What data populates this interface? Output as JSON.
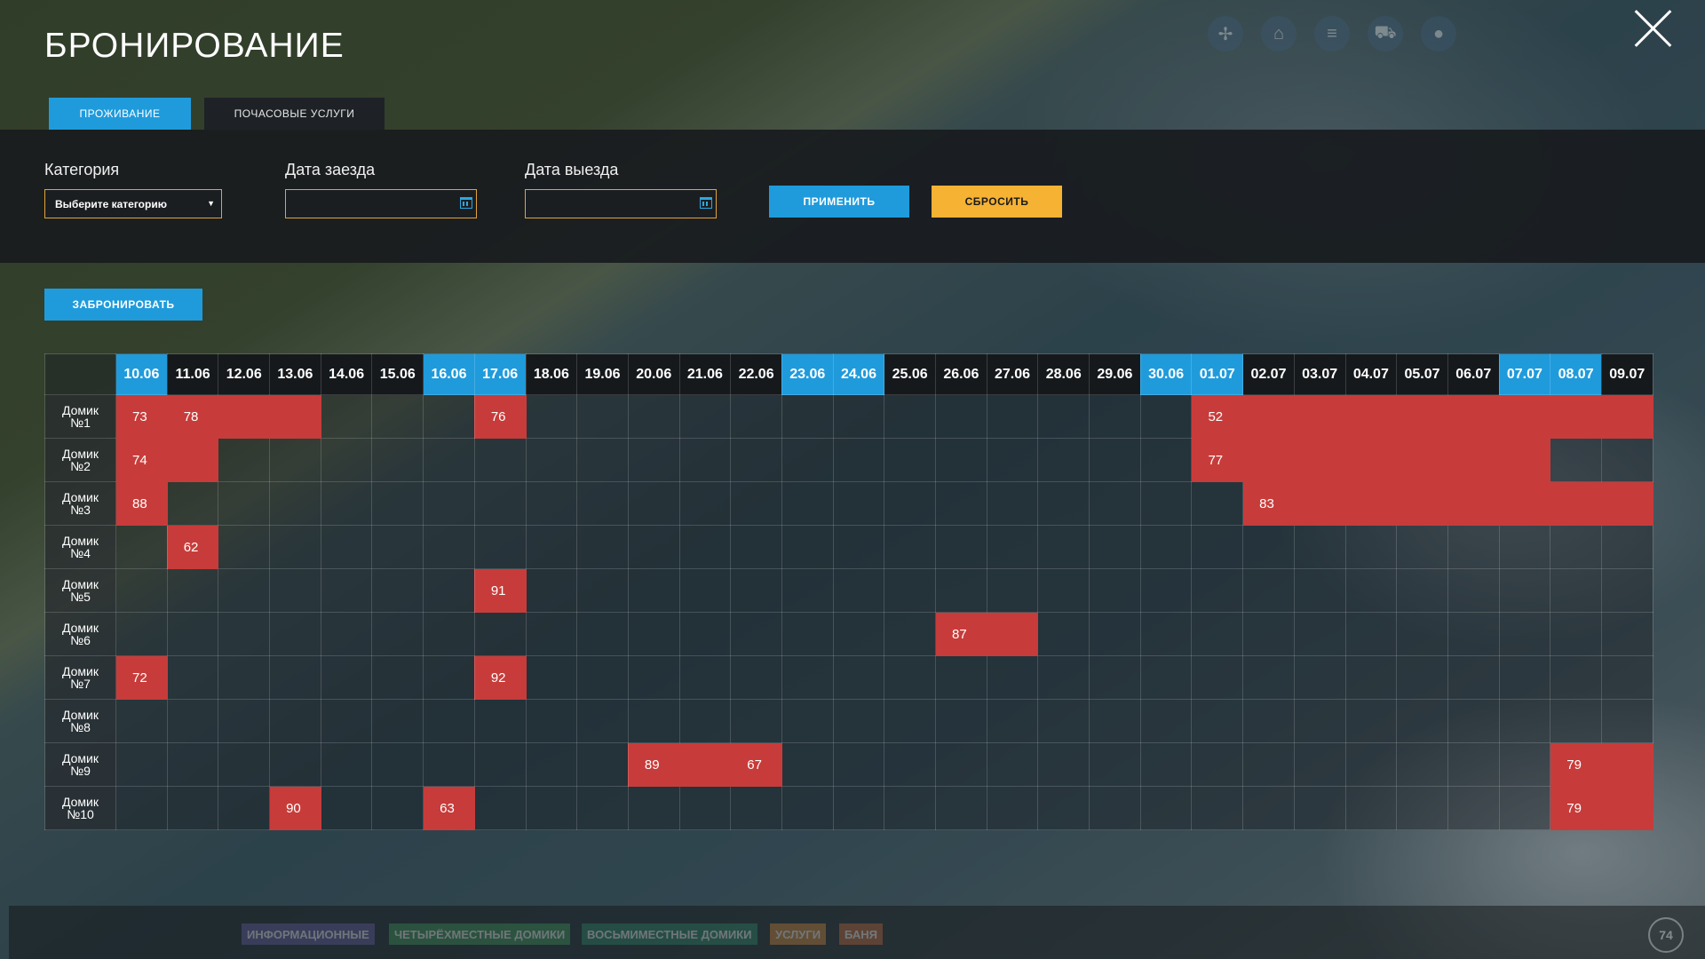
{
  "header": {
    "title": "БРОНИРОВАНИЕ"
  },
  "top_icons": [
    "network-icon",
    "home-icon",
    "menu-icon",
    "cart-icon",
    "map-pin-icon"
  ],
  "tabs": [
    {
      "label": "ПРОЖИВАНИЕ",
      "active": true
    },
    {
      "label": "ПОЧАСОВЫЕ УСЛУГИ",
      "active": false
    }
  ],
  "filters": {
    "category_label": "Категория",
    "category_value": "Выберите категорию",
    "checkin_label": "Дата заезда",
    "checkin_value": "",
    "checkout_label": "Дата выезда",
    "checkout_value": "",
    "apply_label": "ПРИМЕНИТЬ",
    "reset_label": "СБРОСИТЬ"
  },
  "book_label": "ЗАБРОНИРОВАТЬ",
  "colors": {
    "accent": "#1f9bdc",
    "booked": "#c73c3a",
    "reset": "#f5b233",
    "field_border": "#e3a23a"
  },
  "grid": {
    "dates": [
      "10.06",
      "11.06",
      "12.06",
      "13.06",
      "14.06",
      "15.06",
      "16.06",
      "17.06",
      "18.06",
      "19.06",
      "20.06",
      "21.06",
      "22.06",
      "23.06",
      "24.06",
      "25.06",
      "26.06",
      "27.06",
      "28.06",
      "29.06",
      "30.06",
      "01.07",
      "02.07",
      "03.07",
      "04.07",
      "05.07",
      "06.07",
      "07.07",
      "08.07",
      "09.07"
    ],
    "highlighted": [
      "10.06",
      "16.06",
      "17.06",
      "23.06",
      "24.06",
      "30.06",
      "01.07",
      "07.07",
      "08.07"
    ],
    "rows": [
      {
        "house": "Домик",
        "num": "№1",
        "bookings": [
          {
            "start": "10.06",
            "days": 1,
            "label": "73"
          },
          {
            "start": "11.06",
            "days": 3,
            "label": "78"
          },
          {
            "start": "17.06",
            "days": 1,
            "label": "76"
          },
          {
            "start": "01.07",
            "days": 9,
            "label": "52"
          }
        ]
      },
      {
        "house": "Домик",
        "num": "№2",
        "bookings": [
          {
            "start": "10.06",
            "days": 2,
            "label": "74"
          },
          {
            "start": "01.07",
            "days": 7,
            "label": "77"
          }
        ]
      },
      {
        "house": "Домик",
        "num": "№3",
        "bookings": [
          {
            "start": "10.06",
            "days": 1,
            "label": "88"
          },
          {
            "start": "02.07",
            "days": 8,
            "label": "83"
          }
        ]
      },
      {
        "house": "Домик",
        "num": "№4",
        "bookings": [
          {
            "start": "11.06",
            "days": 1,
            "label": "62"
          }
        ]
      },
      {
        "house": "Домик",
        "num": "№5",
        "bookings": [
          {
            "start": "17.06",
            "days": 1,
            "label": "91"
          }
        ]
      },
      {
        "house": "Домик",
        "num": "№6",
        "bookings": [
          {
            "start": "26.06",
            "days": 2,
            "label": "87"
          }
        ]
      },
      {
        "house": "Домик",
        "num": "№7",
        "bookings": [
          {
            "start": "10.06",
            "days": 1,
            "label": "72"
          },
          {
            "start": "17.06",
            "days": 1,
            "label": "92"
          }
        ]
      },
      {
        "house": "Домик",
        "num": "№8",
        "bookings": []
      },
      {
        "house": "Домик",
        "num": "№9",
        "bookings": [
          {
            "start": "20.06",
            "days": 2,
            "label": "89"
          },
          {
            "start": "22.06",
            "days": 1,
            "label": "67"
          },
          {
            "start": "08.07",
            "days": 2,
            "label": "79"
          }
        ]
      },
      {
        "house": "Домик",
        "num": "№10",
        "bookings": [
          {
            "start": "13.06",
            "days": 1,
            "label": "90"
          },
          {
            "start": "16.06",
            "days": 1,
            "label": "63"
          },
          {
            "start": "08.07",
            "days": 2,
            "label": "79"
          }
        ]
      }
    ]
  },
  "footer": [
    {
      "label": "ИНФОРМАЦИОННЫЕ",
      "color": "#6a5fa8"
    },
    {
      "label": "ЧЕТЫРЁХМЕСТНЫЕ ДОМИКИ",
      "color": "#3f9a5a"
    },
    {
      "label": "ВОСЬМИМЕСТНЫЕ ДОМИКИ",
      "color": "#2f8a6a"
    },
    {
      "label": "УСЛУГИ",
      "color": "#d98a3a"
    },
    {
      "label": "БАНЯ",
      "color": "#c86a3a"
    }
  ],
  "logo_text": "74"
}
